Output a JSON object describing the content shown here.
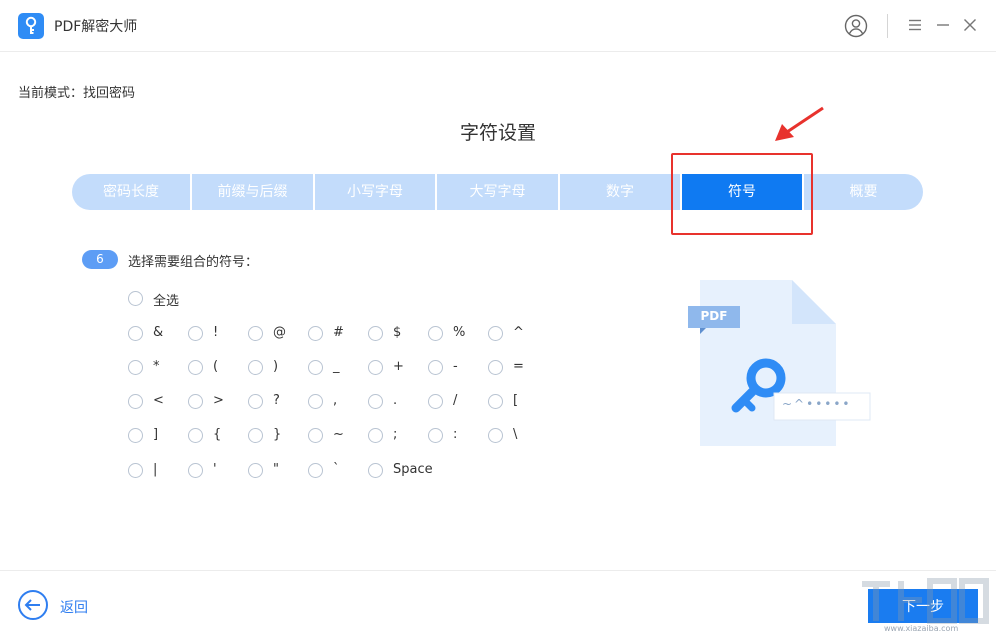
{
  "app": {
    "title": "PDF解密大师"
  },
  "mode": {
    "label": "当前模式：",
    "value": "找回密码"
  },
  "page": {
    "title": "字符设置"
  },
  "steps": [
    {
      "label": "密码长度",
      "active": false
    },
    {
      "label": "前缀与后缀",
      "active": false
    },
    {
      "label": "小写字母",
      "active": false
    },
    {
      "label": "大写字母",
      "active": false
    },
    {
      "label": "数字",
      "active": false
    },
    {
      "label": "符号",
      "active": true
    },
    {
      "label": "概要",
      "active": false
    }
  ],
  "section": {
    "number": "6",
    "label": "选择需要组合的符号："
  },
  "select_all": {
    "label": "全选",
    "checked": false
  },
  "symbols": [
    [
      "&",
      "!",
      "@",
      "#",
      "$",
      "%",
      "^"
    ],
    [
      "*",
      "(",
      ")",
      "_",
      "+",
      "-",
      "="
    ],
    [
      "<",
      ">",
      "?",
      ",",
      ".",
      "/",
      "["
    ],
    [
      "]",
      "{",
      "}",
      "~",
      ";",
      ":",
      "\\"
    ],
    [
      "|",
      "'",
      "\"",
      "`",
      "Space"
    ]
  ],
  "illustration": {
    "badge": "PDF",
    "password_hint": "~^•••••"
  },
  "footer": {
    "back_label": "返回",
    "next_label": "下一步"
  },
  "watermark": {
    "site": "www.xiazaiba.com"
  },
  "colors": {
    "accent": "#0f7af2",
    "tab_inactive": "#c3dcfb",
    "highlight": "#e8322d"
  }
}
